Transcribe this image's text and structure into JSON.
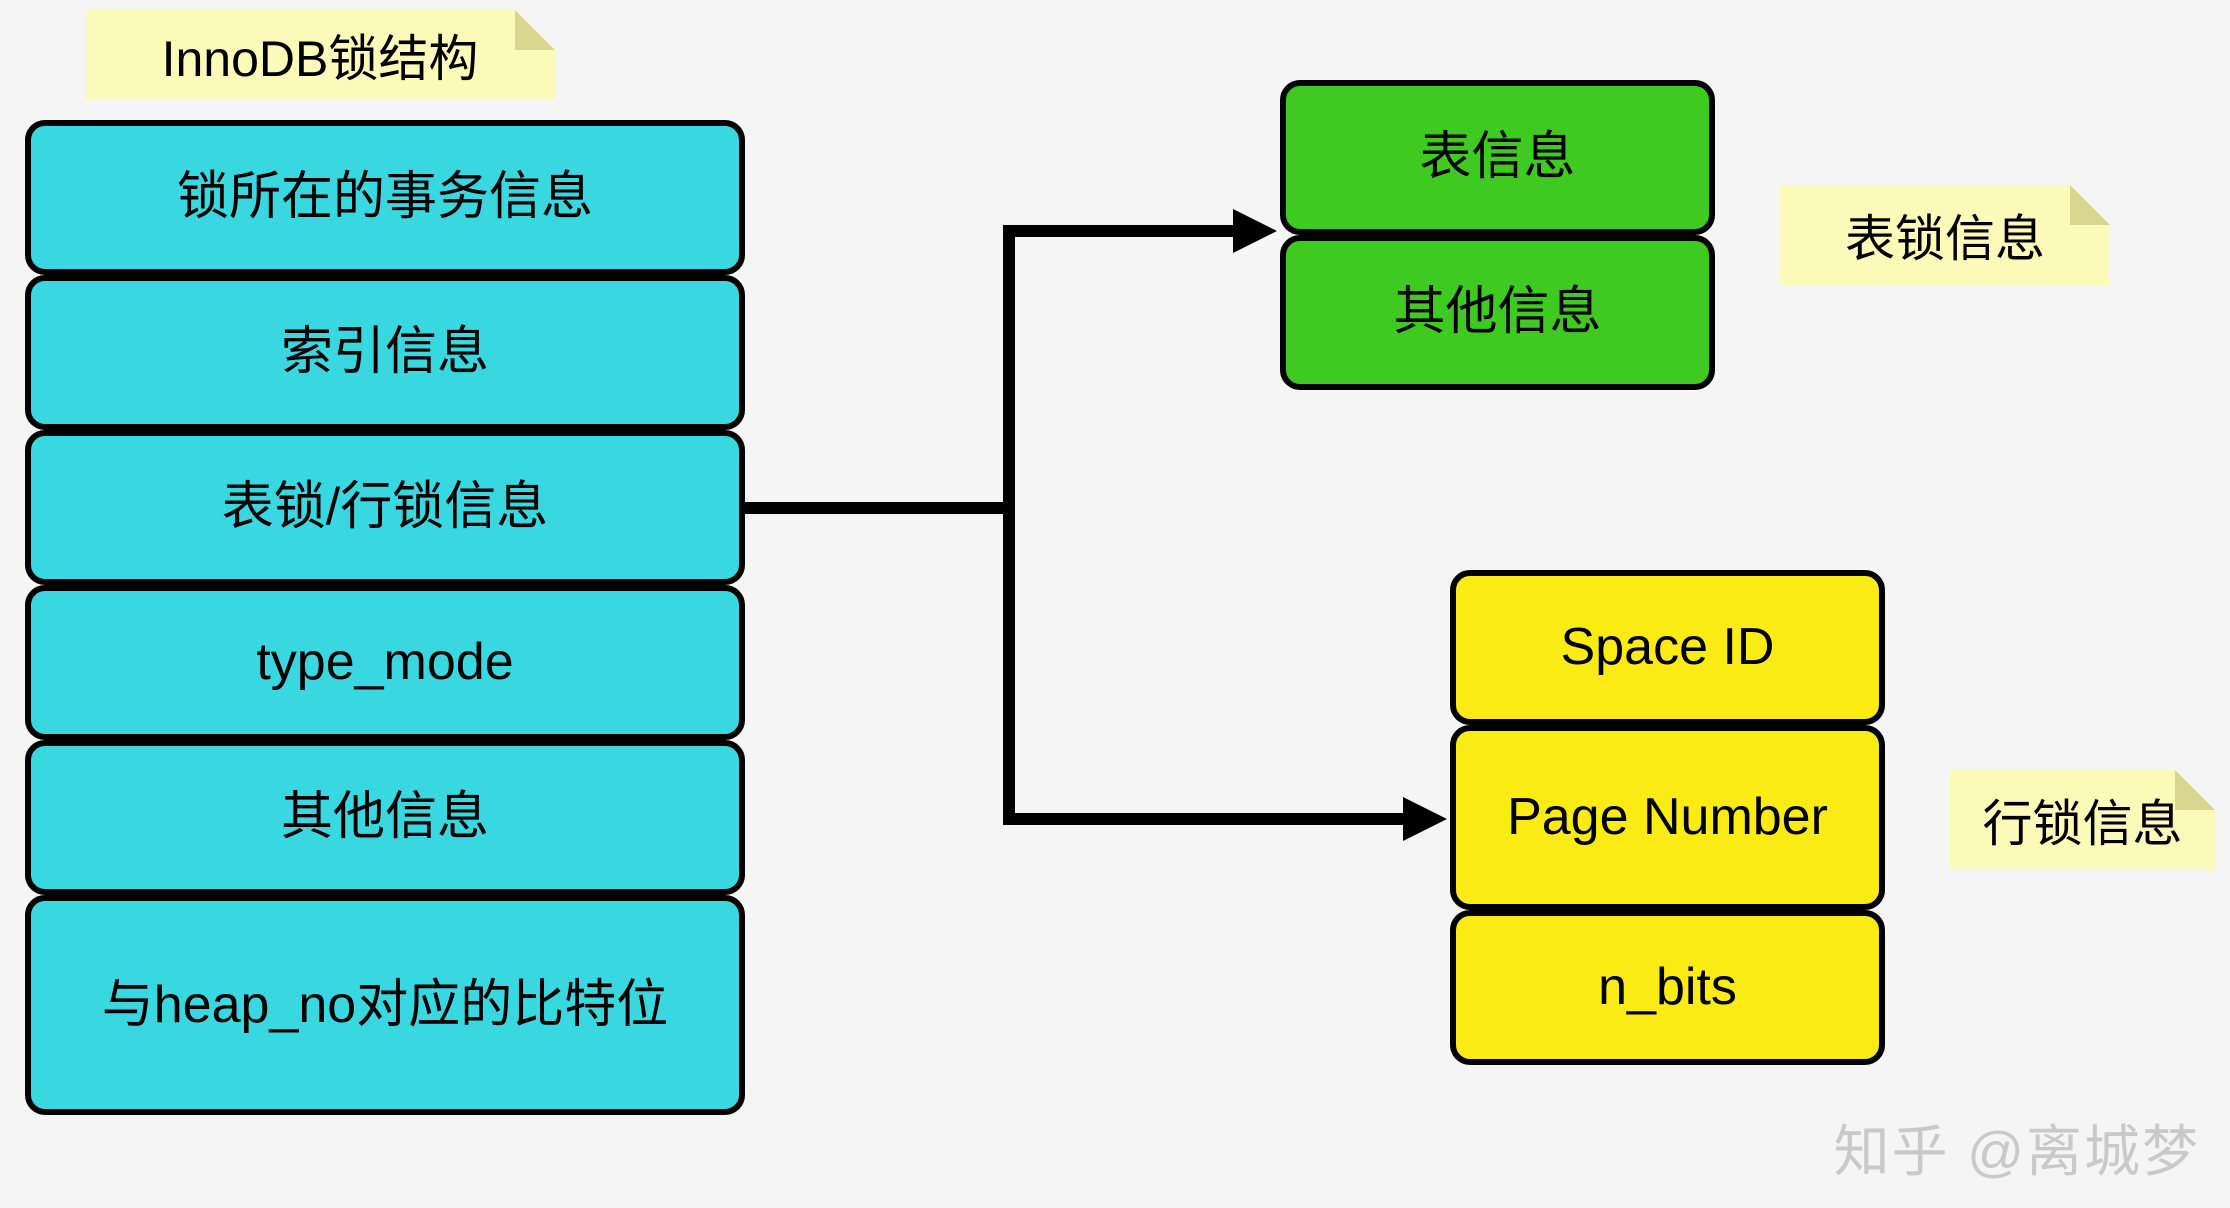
{
  "notes": {
    "main_title": "InnoDB锁结构",
    "table_lock_label": "表锁信息",
    "row_lock_label": "行锁信息"
  },
  "main_stack": {
    "items": [
      "锁所在的事务信息",
      "索引信息",
      "表锁/行锁信息",
      "type_mode",
      "其他信息",
      "与heap_no对应的比特位"
    ]
  },
  "table_lock_stack": {
    "items": [
      "表信息",
      "其他信息"
    ]
  },
  "row_lock_stack": {
    "items": [
      "Space ID",
      "Page Number",
      "n_bits"
    ]
  },
  "watermark": "知乎 @离城梦",
  "colors": {
    "cyan": "#39d7e0",
    "green": "#3eca20",
    "yellow": "#f9eb13",
    "note_bg": "#fbfab9"
  }
}
